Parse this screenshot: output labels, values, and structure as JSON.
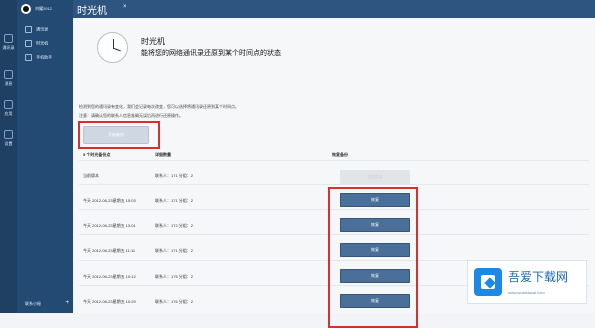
{
  "rail": {
    "labels": [
      "通讯录",
      "消息",
      "应用",
      "设置"
    ]
  },
  "sidebar": {
    "username": "刘耀2012",
    "items": [
      {
        "label": "通讯录",
        "selected": false
      },
      {
        "label": "时光机",
        "selected": true
      },
      {
        "label": "手机助手",
        "selected": false
      }
    ],
    "bottom_label": "联系小秘",
    "bottom_plus": "+"
  },
  "topbar": {
    "title": "时光机",
    "tab_close": "×"
  },
  "hero": {
    "title": "时光机",
    "subtitle": "能将您的网络通讯录还原到某个时间点的状态"
  },
  "description": {
    "line1": "检测到您的通讯录有变化，我们会记录每次改变，您可以选择将通讯录还原到某个时间点。",
    "line2": "注意：请确认您的联系人信息准确无误后再进行还原操作。"
  },
  "start_button": {
    "label": "开始备份"
  },
  "table": {
    "headers": [
      "5 个时光备份点",
      "详细数量",
      "恢复备份"
    ],
    "rows": [
      {
        "time": "当前版本",
        "count": "联系人：171  分组：2",
        "action": "当前版本",
        "disabled": true
      },
      {
        "time": "今天 2012-06-23星期五 15:03",
        "count": "联系人：171  分组：2",
        "action": "恢复",
        "disabled": false
      },
      {
        "time": "今天 2012-06-23星期五 13:01",
        "count": "联系人：172  分组：2",
        "action": "恢复",
        "disabled": false
      },
      {
        "time": "今天 2012-06-23星期五 11:11",
        "count": "联系人：171  分组：2",
        "action": "恢复",
        "disabled": false
      },
      {
        "time": "今天 2012-06-23星期五 10:12",
        "count": "联系人：175  分组：2",
        "action": "恢复",
        "disabled": false
      },
      {
        "time": "今天 2012-06-23星期五 10:29",
        "count": "联系人：176  分组：2",
        "action": "恢复",
        "disabled": false
      }
    ]
  },
  "watermark": {
    "brand": "吾爱下载网",
    "url": "www.wuaixiazai.com"
  },
  "colors": {
    "sidebar": "#234a72",
    "rail": "#1f3f63",
    "accent": "#4a6f99",
    "highlight": "#d82f2f"
  }
}
